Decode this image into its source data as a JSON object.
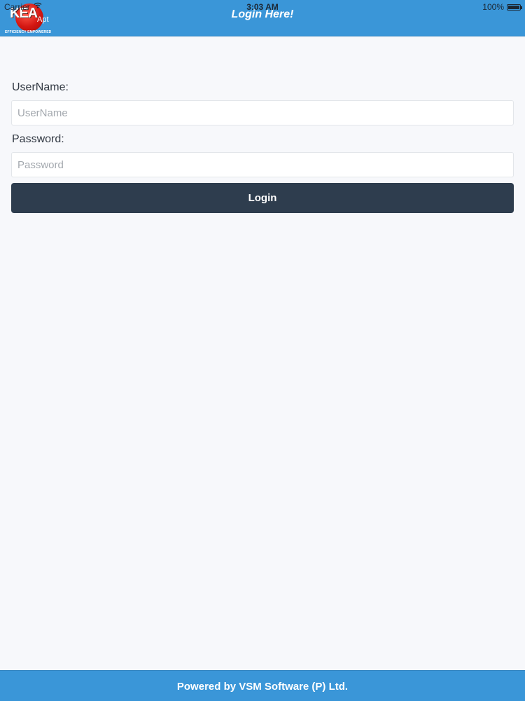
{
  "status_bar": {
    "carrier": "Carrier",
    "time": "3:03 AM",
    "battery": "100%",
    "wifi_icon": "wifi-icon",
    "battery_icon": "battery-icon"
  },
  "header": {
    "logo": {
      "text": "KEA",
      "suffix": "Apt",
      "tagline": "EFFICIENCY EMPOWERED"
    },
    "title": "Login Here!",
    "background_color": "#3a96d8"
  },
  "form": {
    "username": {
      "label": "UserName:",
      "placeholder": "UserName",
      "value": ""
    },
    "password": {
      "label": "Password:",
      "placeholder": "Password",
      "value": ""
    },
    "login_button": {
      "label": "Login",
      "color": "#2e3d4e"
    }
  },
  "footer": {
    "text": "Powered by VSM Software (P) Ltd."
  }
}
